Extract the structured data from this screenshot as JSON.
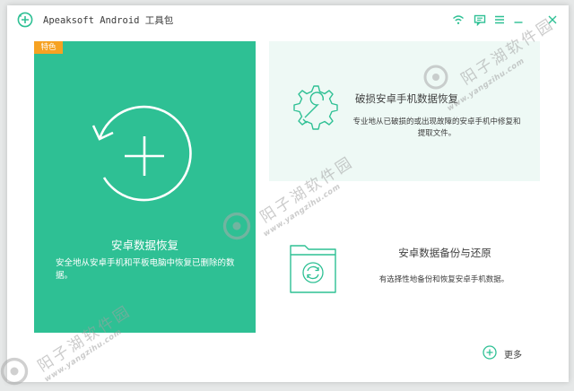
{
  "window": {
    "title": "Apeaksoft Android 工具包"
  },
  "titlebar_icons": [
    {
      "name": "wifi-icon"
    },
    {
      "name": "feedback-icon"
    },
    {
      "name": "menu-icon"
    },
    {
      "name": "minimize-icon"
    },
    {
      "name": "close-icon"
    }
  ],
  "cards": {
    "recovery": {
      "badge": "特色",
      "title": "安卓数据恢复",
      "description": "安全地从安卓手机和平板电脑中恢复已删除的数据。"
    },
    "broken": {
      "title": "破损安卓手机数据恢复",
      "description": "专业地从已破损的或出现故障的安卓手机中修复和提取文件。"
    },
    "backup": {
      "title": "安卓数据备份与还原",
      "description": "有选择性地备份和恢复安卓手机数据。"
    }
  },
  "more": {
    "label": "更多"
  },
  "watermark": {
    "text": "阳子湖软件园",
    "url": "www.yangzihu.com"
  },
  "colors": {
    "accent": "#2ec094",
    "badge": "#f6a222",
    "card_tint": "#eef9f5"
  }
}
